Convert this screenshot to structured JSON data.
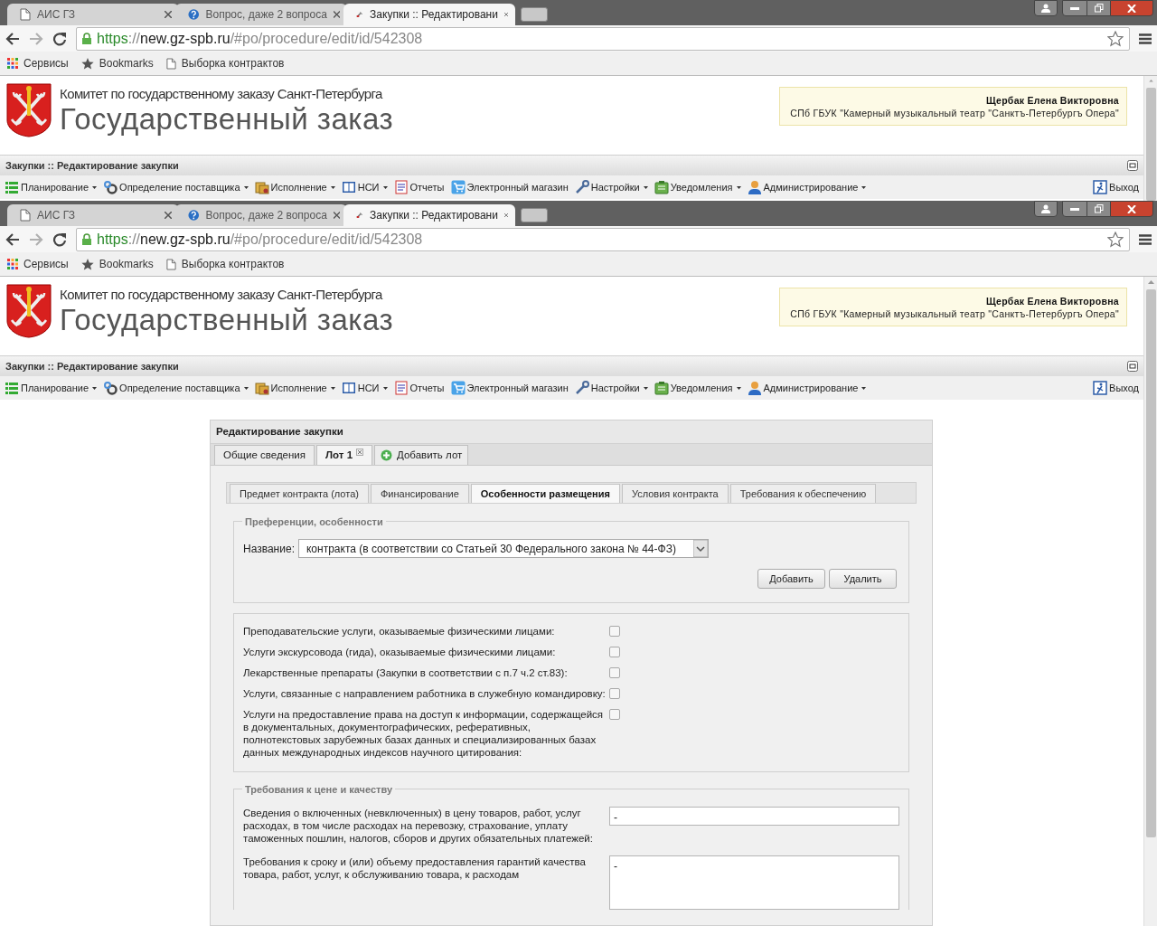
{
  "frames": [
    {
      "tabs": [
        {
          "title": "АИС ГЗ",
          "selected": false
        },
        {
          "title": "Вопрос, даже 2 вопроса",
          "selected": false
        },
        {
          "title": "Закупки :: Редактировани",
          "selected": true
        }
      ],
      "url_parts": [
        "https",
        "://",
        "new.gz-spb.ru",
        "/#po/procedure/edit/id/542308"
      ],
      "bookmarks": [
        "Сервисы",
        "Bookmarks",
        "Выборка контрактов"
      ],
      "header": {
        "committee": "Комитет по государственному заказу Санкт-Петербурга",
        "brand": "Государственный заказ",
        "user_name": "Щербак Елена Викторовна",
        "organization": "СПб ГБУК \"Камерный музыкальный театр \"Санктъ-Петербургъ Опера\""
      },
      "page_title": "Закупки :: Редактирование закупки",
      "menu": [
        {
          "label": "Планирование",
          "dropdown": true
        },
        {
          "label": "Определение поставщика",
          "dropdown": true
        },
        {
          "label": "Исполнение",
          "dropdown": true
        },
        {
          "label": "НСИ",
          "dropdown": true
        },
        {
          "label": "Отчеты",
          "dropdown": false
        },
        {
          "label": "Электронный магазин",
          "dropdown": false
        },
        {
          "label": "Настройки",
          "dropdown": true
        },
        {
          "label": "Уведомления",
          "dropdown": true
        },
        {
          "label": "Администрирование",
          "dropdown": true
        }
      ],
      "logout": "Выход"
    },
    {
      "tabs": [
        {
          "title": "АИС ГЗ",
          "selected": false
        },
        {
          "title": "Вопрос, даже 2 вопроса",
          "selected": false
        },
        {
          "title": "Закупки :: Редактировани",
          "selected": true
        }
      ],
      "url_parts": [
        "https",
        "://",
        "new.gz-spb.ru",
        "/#po/procedure/edit/id/542308"
      ],
      "bookmarks": [
        "Сервисы",
        "Bookmarks",
        "Выборка контрактов"
      ],
      "header": {
        "committee": "Комитет по государственному заказу Санкт-Петербурга",
        "brand": "Государственный заказ",
        "user_name": "Щербак Елена Викторовна",
        "organization": "СПб ГБУК \"Камерный музыкальный театр \"Санктъ-Петербургъ Опера\""
      },
      "page_title": "Закупки :: Редактирование закупки",
      "menu": [
        {
          "label": "Планирование",
          "dropdown": true
        },
        {
          "label": "Определение поставщика",
          "dropdown": true
        },
        {
          "label": "Исполнение",
          "dropdown": true
        },
        {
          "label": "НСИ",
          "dropdown": true
        },
        {
          "label": "Отчеты",
          "dropdown": false
        },
        {
          "label": "Электронный магазин",
          "dropdown": false
        },
        {
          "label": "Настройки",
          "dropdown": true
        },
        {
          "label": "Уведомления",
          "dropdown": true
        },
        {
          "label": "Администрирование",
          "dropdown": true
        }
      ],
      "logout": "Выход"
    }
  ],
  "form": {
    "title": "Редактирование закупки",
    "tabs": [
      {
        "label": "Общие сведения",
        "selected": false,
        "closable": false
      },
      {
        "label": "Лот 1",
        "selected": true,
        "closable": true
      }
    ],
    "add_lot": "Добавить лот",
    "subtabs": [
      {
        "label": "Предмет контракта (лота)",
        "selected": false
      },
      {
        "label": "Финансирование",
        "selected": false
      },
      {
        "label": "Особенности размещения",
        "selected": true
      },
      {
        "label": "Условия контракта",
        "selected": false
      },
      {
        "label": "Требования к обеспечению",
        "selected": false
      }
    ],
    "preferences": {
      "legend": "Преференции, особенности",
      "name_label": "Название:",
      "name_value": "контракта (в соответствии со Статьей 30 Федерального закона № 44-ФЗ)",
      "buttons": [
        "Добавить",
        "Удалить"
      ]
    },
    "options": [
      {
        "label": "Преподавательские услуги, оказываемые физическими лицами:",
        "checked": false
      },
      {
        "label": "Услуги экскурсовода (гида), оказываемые физическими лицами:",
        "checked": false
      },
      {
        "label": "Лекарственные препараты (Закупки в соответствии с п.7 ч.2 ст.83):",
        "checked": false
      },
      {
        "label": "Услуги, связанные с направлением работника в служебную командировку:",
        "checked": false
      },
      {
        "label": "Услуги на предоставление права на доступ к информации, содержащейся в документальных, документографических, реферативных, полнотекстовых зарубежных базах данных и специализированных базах данных международных индексов научного цитирования:",
        "checked": false
      }
    ],
    "price": {
      "legend": "Требования к цене и качеству",
      "fields": [
        {
          "kind": "line",
          "label": "Сведения о включенных (невключенных) в цену товаров, работ, услуг расходах, в том числе расходах на перевозку, страхование, уплату таможенных пошлин, налогов, сборов и других обязательных платежей:",
          "value": "-"
        },
        {
          "kind": "area",
          "label": "Требования к сроку и (или) объему предоставления гарантий качества товара, работ, услуг, к обслуживанию товара, к расходам",
          "value": "-"
        }
      ]
    }
  }
}
